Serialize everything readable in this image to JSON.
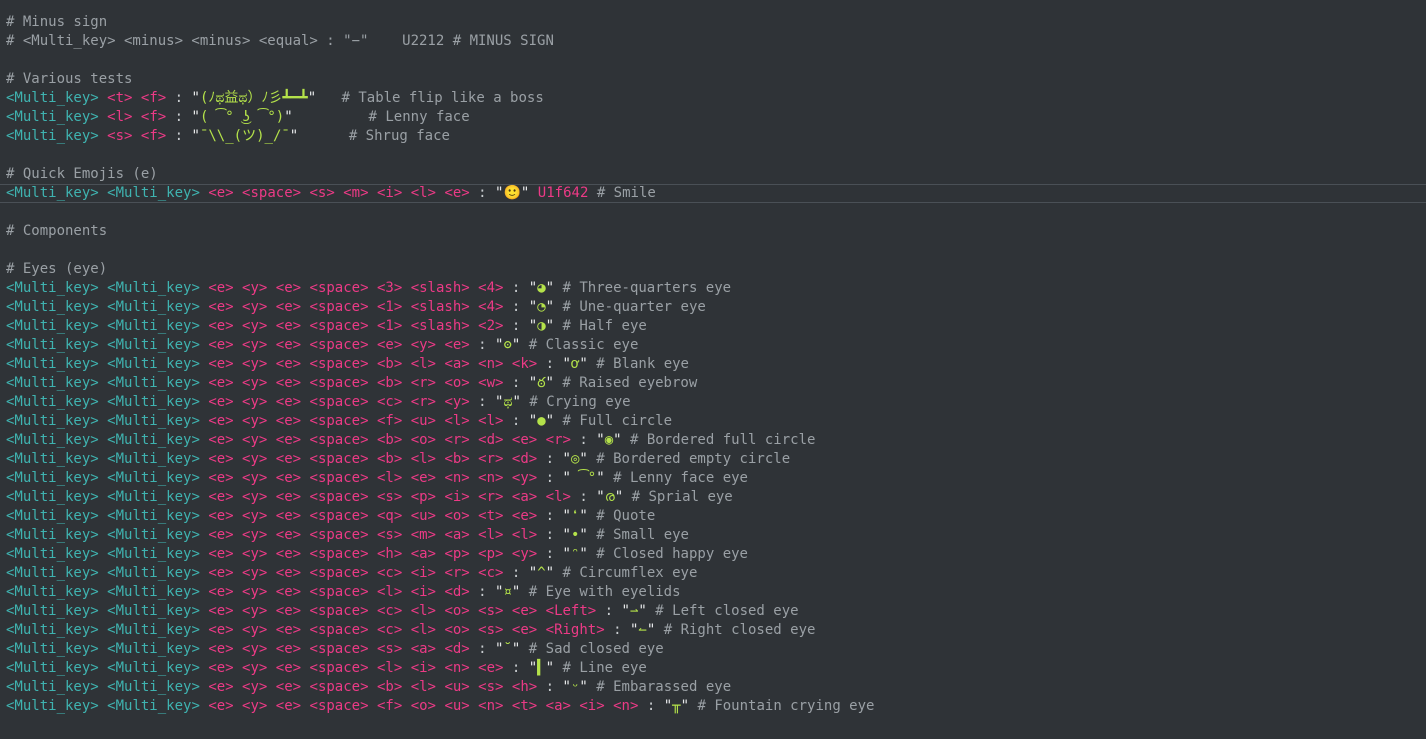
{
  "editor": {
    "lines": [
      {
        "type": "comment",
        "text": "# Minus sign"
      },
      {
        "type": "comment",
        "text": "# <Multi_key> <minus> <minus> <equal> : \"−\"    U2212 # MINUS SIGN"
      },
      {
        "type": "blank"
      },
      {
        "type": "comment",
        "text": "# Various tests"
      },
      {
        "type": "seq",
        "keys": [
          "<Multi_key>",
          "<t>",
          "<f>"
        ],
        "str": "(ﾉಥ益ಥ）ﾉ彡┻━┻",
        "comment": "  # Table flip like a boss"
      },
      {
        "type": "seq",
        "keys": [
          "<Multi_key>",
          "<l>",
          "<f>"
        ],
        "str": "( ͡° ͜ʖ ͡°)",
        "comment": "        # Lenny face"
      },
      {
        "type": "seq",
        "keys": [
          "<Multi_key>",
          "<s>",
          "<f>"
        ],
        "str": "¯\\\\_(ツ)_/¯",
        "comment": "     # Shrug face"
      },
      {
        "type": "blank"
      },
      {
        "type": "comment",
        "text": "# Quick Emojis (e)"
      },
      {
        "type": "seq",
        "current": true,
        "keys": [
          "<Multi_key>",
          "<Multi_key>",
          "<e>",
          "<space>",
          "<s>",
          "<m>",
          "<i>",
          "<l>",
          "<e>"
        ],
        "str": "🙂",
        "code": "U1f642",
        "comment": "# Smile"
      },
      {
        "type": "blank"
      },
      {
        "type": "comment",
        "text": "# Components"
      },
      {
        "type": "blank"
      },
      {
        "type": "comment",
        "text": "# Eyes (eye)"
      },
      {
        "type": "seq",
        "keys": [
          "<Multi_key>",
          "<Multi_key>",
          "<e>",
          "<y>",
          "<e>",
          "<space>",
          "<3>",
          "<slash>",
          "<4>"
        ],
        "str": "◕",
        "comment": "# Three-quarters eye"
      },
      {
        "type": "seq",
        "keys": [
          "<Multi_key>",
          "<Multi_key>",
          "<e>",
          "<y>",
          "<e>",
          "<space>",
          "<1>",
          "<slash>",
          "<4>"
        ],
        "str": "◔",
        "comment": "# Une-quarter eye"
      },
      {
        "type": "seq",
        "keys": [
          "<Multi_key>",
          "<Multi_key>",
          "<e>",
          "<y>",
          "<e>",
          "<space>",
          "<1>",
          "<slash>",
          "<2>"
        ],
        "str": "◑",
        "comment": "# Half eye"
      },
      {
        "type": "seq",
        "keys": [
          "<Multi_key>",
          "<Multi_key>",
          "<e>",
          "<y>",
          "<e>",
          "<space>",
          "<e>",
          "<y>",
          "<e>"
        ],
        "str": "ʘ",
        "comment": "# Classic eye"
      },
      {
        "type": "seq",
        "keys": [
          "<Multi_key>",
          "<Multi_key>",
          "<e>",
          "<y>",
          "<e>",
          "<space>",
          "<b>",
          "<l>",
          "<a>",
          "<n>",
          "<k>"
        ],
        "str": "ơ",
        "comment": "# Blank eye"
      },
      {
        "type": "seq",
        "keys": [
          "<Multi_key>",
          "<Multi_key>",
          "<e>",
          "<y>",
          "<e>",
          "<space>",
          "<b>",
          "<r>",
          "<o>",
          "<w>"
        ],
        "str": "ఠ",
        "comment": "# Raised eyebrow"
      },
      {
        "type": "seq",
        "keys": [
          "<Multi_key>",
          "<Multi_key>",
          "<e>",
          "<y>",
          "<e>",
          "<space>",
          "<c>",
          "<r>",
          "<y>"
        ],
        "str": "ಥ",
        "comment": "# Crying eye"
      },
      {
        "type": "seq",
        "keys": [
          "<Multi_key>",
          "<Multi_key>",
          "<e>",
          "<y>",
          "<e>",
          "<space>",
          "<f>",
          "<u>",
          "<l>",
          "<l>"
        ],
        "str": "●",
        "comment": "# Full circle"
      },
      {
        "type": "seq",
        "keys": [
          "<Multi_key>",
          "<Multi_key>",
          "<e>",
          "<y>",
          "<e>",
          "<space>",
          "<b>",
          "<o>",
          "<r>",
          "<d>",
          "<e>",
          "<r>"
        ],
        "str": "◉",
        "comment": "# Bordered full circle"
      },
      {
        "type": "seq",
        "keys": [
          "<Multi_key>",
          "<Multi_key>",
          "<e>",
          "<y>",
          "<e>",
          "<space>",
          "<b>",
          "<l>",
          "<b>",
          "<r>",
          "<d>"
        ],
        "str": "◎",
        "comment": "# Bordered empty circle"
      },
      {
        "type": "seq",
        "keys": [
          "<Multi_key>",
          "<Multi_key>",
          "<e>",
          "<y>",
          "<e>",
          "<space>",
          "<l>",
          "<e>",
          "<n>",
          "<n>",
          "<y>"
        ],
        "str": " ͡°",
        "comment": "# Lenny face eye"
      },
      {
        "type": "seq",
        "keys": [
          "<Multi_key>",
          "<Multi_key>",
          "<e>",
          "<y>",
          "<e>",
          "<space>",
          "<s>",
          "<p>",
          "<i>",
          "<r>",
          "<a>",
          "<l>"
        ],
        "str": "ര",
        "comment": "# Sprial eye"
      },
      {
        "type": "seq",
        "keys": [
          "<Multi_key>",
          "<Multi_key>",
          "<e>",
          "<y>",
          "<e>",
          "<space>",
          "<q>",
          "<u>",
          "<o>",
          "<t>",
          "<e>"
        ],
        "str": "❛",
        "comment": "# Quote"
      },
      {
        "type": "seq",
        "keys": [
          "<Multi_key>",
          "<Multi_key>",
          "<e>",
          "<y>",
          "<e>",
          "<space>",
          "<s>",
          "<m>",
          "<a>",
          "<l>",
          "<l>"
        ],
        "str": "•",
        "comment": "# Small eye"
      },
      {
        "type": "seq",
        "keys": [
          "<Multi_key>",
          "<Multi_key>",
          "<e>",
          "<y>",
          "<e>",
          "<space>",
          "<h>",
          "<a>",
          "<p>",
          "<p>",
          "<y>"
        ],
        "str": "ᵔ",
        "comment": "# Closed happy eye"
      },
      {
        "type": "seq",
        "keys": [
          "<Multi_key>",
          "<Multi_key>",
          "<e>",
          "<y>",
          "<e>",
          "<space>",
          "<c>",
          "<i>",
          "<r>",
          "<c>"
        ],
        "str": "^",
        "comment": "# Circumflex eye"
      },
      {
        "type": "seq",
        "keys": [
          "<Multi_key>",
          "<Multi_key>",
          "<e>",
          "<y>",
          "<e>",
          "<space>",
          "<l>",
          "<i>",
          "<d>"
        ],
        "str": "¤",
        "comment": "# Eye with eyelids"
      },
      {
        "type": "seq",
        "keys": [
          "<Multi_key>",
          "<Multi_key>",
          "<e>",
          "<y>",
          "<e>",
          "<space>",
          "<c>",
          "<l>",
          "<o>",
          "<s>",
          "<e>",
          "<Left>"
        ],
        "str": "⇀",
        "comment": "# Left closed eye"
      },
      {
        "type": "seq",
        "keys": [
          "<Multi_key>",
          "<Multi_key>",
          "<e>",
          "<y>",
          "<e>",
          "<space>",
          "<c>",
          "<l>",
          "<o>",
          "<s>",
          "<e>",
          "<Right>"
        ],
        "str": "↼",
        "comment": "# Right closed eye"
      },
      {
        "type": "seq",
        "keys": [
          "<Multi_key>",
          "<Multi_key>",
          "<e>",
          "<y>",
          "<e>",
          "<space>",
          "<s>",
          "<a>",
          "<d>"
        ],
        "str": "˘",
        "comment": "# Sad closed eye"
      },
      {
        "type": "seq",
        "keys": [
          "<Multi_key>",
          "<Multi_key>",
          "<e>",
          "<y>",
          "<e>",
          "<space>",
          "<l>",
          "<i>",
          "<n>",
          "<e>"
        ],
        "str": "▍",
        "comment": "# Line eye"
      },
      {
        "type": "seq",
        "keys": [
          "<Multi_key>",
          "<Multi_key>",
          "<e>",
          "<y>",
          "<e>",
          "<space>",
          "<b>",
          "<l>",
          "<u>",
          "<s>",
          "<h>"
        ],
        "str": "ᵕ",
        "comment": "# Embarassed eye"
      },
      {
        "type": "seq",
        "keys": [
          "<Multi_key>",
          "<Multi_key>",
          "<e>",
          "<y>",
          "<e>",
          "<space>",
          "<f>",
          "<o>",
          "<u>",
          "<n>",
          "<t>",
          "<a>",
          "<i>",
          "<n>"
        ],
        "str": "╥",
        "comment": "# Fountain crying eye"
      }
    ]
  }
}
